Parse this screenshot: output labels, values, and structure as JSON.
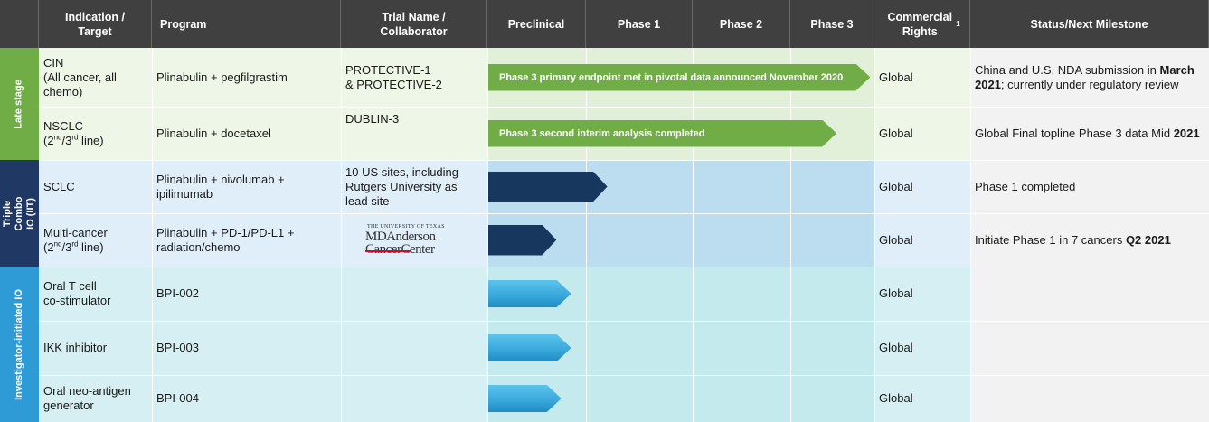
{
  "headers": {
    "indication": "Indication / Target",
    "program": "Program",
    "trial": "Trial Name / Collaborator",
    "preclinical": "Preclinical",
    "phase1": "Phase 1",
    "phase2": "Phase 2",
    "phase3": "Phase 3",
    "rights": "Commercial Rights",
    "rights_sup": "1",
    "status": "Status/Next Milestone"
  },
  "sections": [
    {
      "label": "Late stage",
      "color": "#70ad47"
    },
    {
      "label": "Triple Combo IO (IIT)",
      "color": "#1f3864"
    },
    {
      "label": "Investigator-initiated IO",
      "color": "#2e9bd6"
    }
  ],
  "rows": [
    {
      "indication_lines": [
        "CIN",
        "(All cancer, all",
        "chemo)"
      ],
      "program": "Plinabulin + pegfilgrastim",
      "trial_lines": [
        "PROTECTIVE-1",
        "& PROTECTIVE-2"
      ],
      "arrow_label": "Phase 3 primary endpoint met in pivotal data announced November 2020",
      "progress_phase": 3.95,
      "rights": "Global",
      "status_parts": [
        {
          "t": "China and U.S. NDA submission in ",
          "b": false
        },
        {
          "t": "March 2021",
          "b": true
        },
        {
          "t": "; currently under regulatory review",
          "b": false
        }
      ]
    },
    {
      "indication_html": "NSCLC<br>(2<sup>nd</sup>/3<sup>rd</sup> line)",
      "program": "Plinabulin + docetaxel",
      "trial_lines": [
        "DUBLIN-3"
      ],
      "arrow_label": "Phase 3 second interim analysis completed",
      "progress_phase": 3.55,
      "rights": "Global",
      "status_parts": [
        {
          "t": "Global Final topline Phase 3 data Mid ",
          "b": false
        },
        {
          "t": "2021",
          "b": true
        }
      ]
    },
    {
      "indication_lines": [
        "SCLC"
      ],
      "program": "Plinabulin + nivolumab + ipilimumab",
      "trial_lines": [
        "10 US sites, including",
        "Rutgers University as",
        "lead site"
      ],
      "arrow_label": "",
      "progress_phase": 1.2,
      "rights": "Global",
      "status_parts": [
        {
          "t": "Phase 1 completed",
          "b": false
        }
      ]
    },
    {
      "indication_html": "Multi-cancer<br>(2<sup>nd</sup>/3<sup>rd</sup> line)",
      "program": "Plinabulin + PD-1/PD-L1 + radiation/chemo",
      "trial_lines": [],
      "logo": {
        "top": "THE UNIVERSITY OF TEXAS",
        "line1": "MDAnderson",
        "line2": "CancerCenter"
      },
      "arrow_label": "",
      "progress_phase": 0.7,
      "rights": "Global",
      "status_parts": [
        {
          "t": "Initiate Phase 1 in 7 cancers ",
          "b": false
        },
        {
          "t": "Q2 2021",
          "b": true
        }
      ]
    },
    {
      "indication_lines": [
        "Oral T cell",
        "co-stimulator"
      ],
      "program": "BPI-002",
      "trial_lines": [],
      "arrow_label": "",
      "progress_phase": 0.85,
      "rights": "Global",
      "status_parts": []
    },
    {
      "indication_lines": [
        "IKK inhibitor"
      ],
      "program": "BPI-003",
      "trial_lines": [],
      "arrow_label": "",
      "progress_phase": 0.85,
      "rights": "Global",
      "status_parts": []
    },
    {
      "indication_lines": [
        "Oral neo-antigen",
        "generator"
      ],
      "program": "BPI-004",
      "trial_lines": [],
      "arrow_label": "",
      "progress_phase": 0.75,
      "rights": "Global",
      "status_parts": []
    }
  ],
  "colors": {
    "header_bg": "#404040",
    "late_arrow": "#70ad47",
    "combo_arrow": "#17375e",
    "iit_arrow": "#3aa9dc"
  }
}
